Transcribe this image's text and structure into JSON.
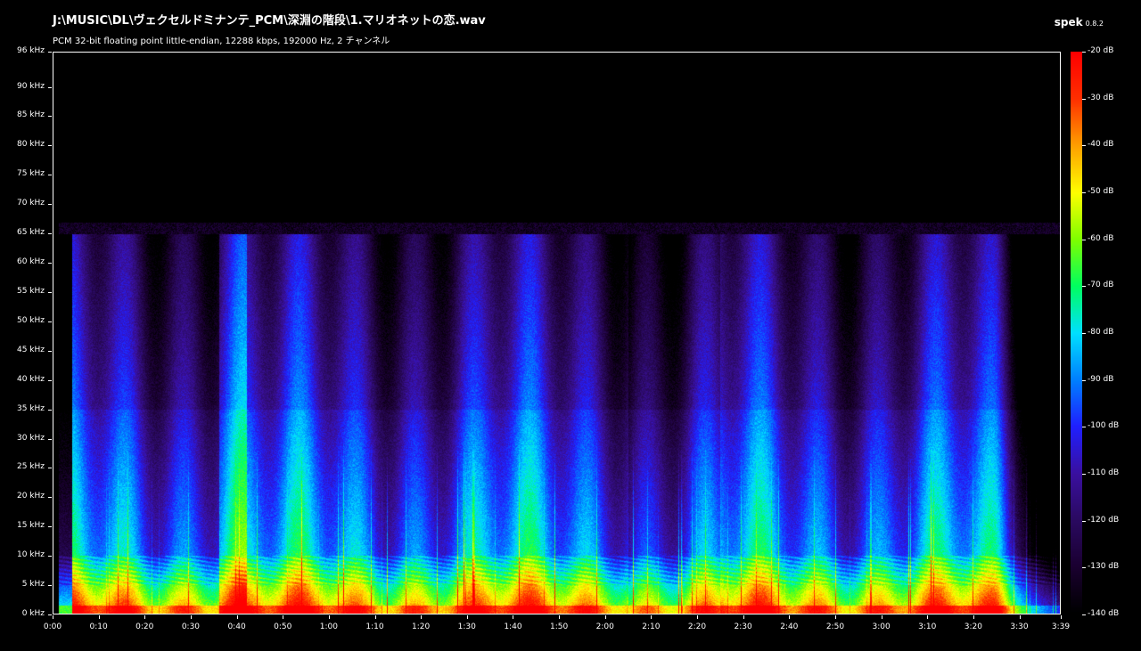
{
  "header": {
    "title": "J:\\MUSIC\\DL\\ヴェクセルドミナンテ_PCM\\深淵の階段\\1.マリオネットの恋.wav",
    "subtitle": "PCM 32-bit floating point little-endian, 12288 kbps, 192000 Hz, 2 チャンネル",
    "app_name": "spek",
    "app_version": "0.8.2"
  },
  "chart_data": {
    "type": "heatmap",
    "title": "J:\\MUSIC\\DL\\ヴェクセルドミナンテ_PCM\\深淵の階段\\1.マリオネットの恋.wav",
    "xlabel": "",
    "ylabel": "",
    "x_ticks": [
      "0:00",
      "0:10",
      "0:20",
      "0:30",
      "0:40",
      "0:50",
      "1:00",
      "1:10",
      "1:20",
      "1:30",
      "1:40",
      "1:50",
      "2:00",
      "2:10",
      "2:20",
      "2:30",
      "2:40",
      "2:50",
      "3:00",
      "3:10",
      "3:20",
      "3:30",
      "3:39"
    ],
    "x_tick_seconds": [
      0,
      10,
      20,
      30,
      40,
      50,
      60,
      70,
      80,
      90,
      100,
      110,
      120,
      130,
      140,
      150,
      160,
      170,
      180,
      190,
      200,
      210,
      219
    ],
    "xlim": [
      0,
      219
    ],
    "y_ticks": [
      "0 kHz",
      "5 kHz",
      "10 kHz",
      "15 kHz",
      "20 kHz",
      "25 kHz",
      "30 kHz",
      "35 kHz",
      "40 kHz",
      "45 kHz",
      "50 kHz",
      "55 kHz",
      "60 kHz",
      "65 kHz",
      "70 kHz",
      "75 kHz",
      "80 kHz",
      "85 kHz",
      "90 kHz",
      "96 kHz"
    ],
    "y_tick_khz": [
      0,
      5,
      10,
      15,
      20,
      25,
      30,
      35,
      40,
      45,
      50,
      55,
      60,
      65,
      70,
      75,
      80,
      85,
      90,
      96
    ],
    "ylim": [
      0,
      96
    ],
    "colorbar_ticks": [
      "-20 dB",
      "-30 dB",
      "-40 dB",
      "-50 dB",
      "-60 dB",
      "-70 dB",
      "-80 dB",
      "-90 dB",
      "-100 dB",
      "-110 dB",
      "-120 dB",
      "-130 dB",
      "-140 dB"
    ],
    "colorbar_db": [
      -20,
      -30,
      -40,
      -50,
      -60,
      -70,
      -80,
      -90,
      -100,
      -110,
      -120,
      -130,
      -140
    ],
    "colorbar_range": [
      -140,
      -20
    ],
    "colormap": [
      "#000000",
      "#1a0030",
      "#2a0a60",
      "#3a10a0",
      "#2020ff",
      "#0080ff",
      "#00e0ff",
      "#00ff60",
      "#80ff00",
      "#ffff00",
      "#ffa000",
      "#ff3000",
      "#ff0000"
    ],
    "signal_extent_khz": 65,
    "signal_start_s": 1,
    "signal_end_s": 212
  }
}
